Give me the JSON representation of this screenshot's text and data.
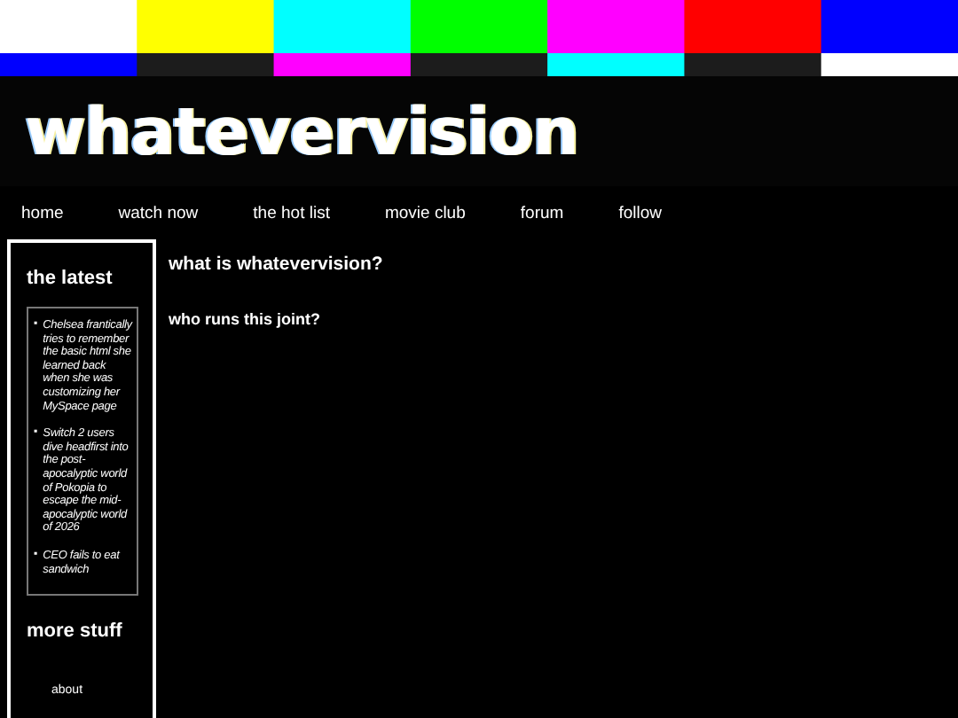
{
  "site_title": "whatevervision",
  "nav": [
    "home",
    "watch now",
    "the hot list",
    "movie club",
    "forum",
    "follow"
  ],
  "sidebar": {
    "latest_heading": "the latest",
    "latest_bullet": "▪",
    "latest_items": [
      "Chelsea frantically tries to remember the basic html she learned back when she was customizing her MySpace page",
      "Switch 2 users dive headfirst into the post-apocalyptic world of Pokopia to escape the mid-apocalyptic world of 2026",
      "CEO fails to eat sandwich"
    ],
    "more_heading": "more stuff",
    "more_links": [
      "about"
    ]
  },
  "main": {
    "headings": [
      "what is whatevervision?",
      "who runs this joint?"
    ]
  }
}
